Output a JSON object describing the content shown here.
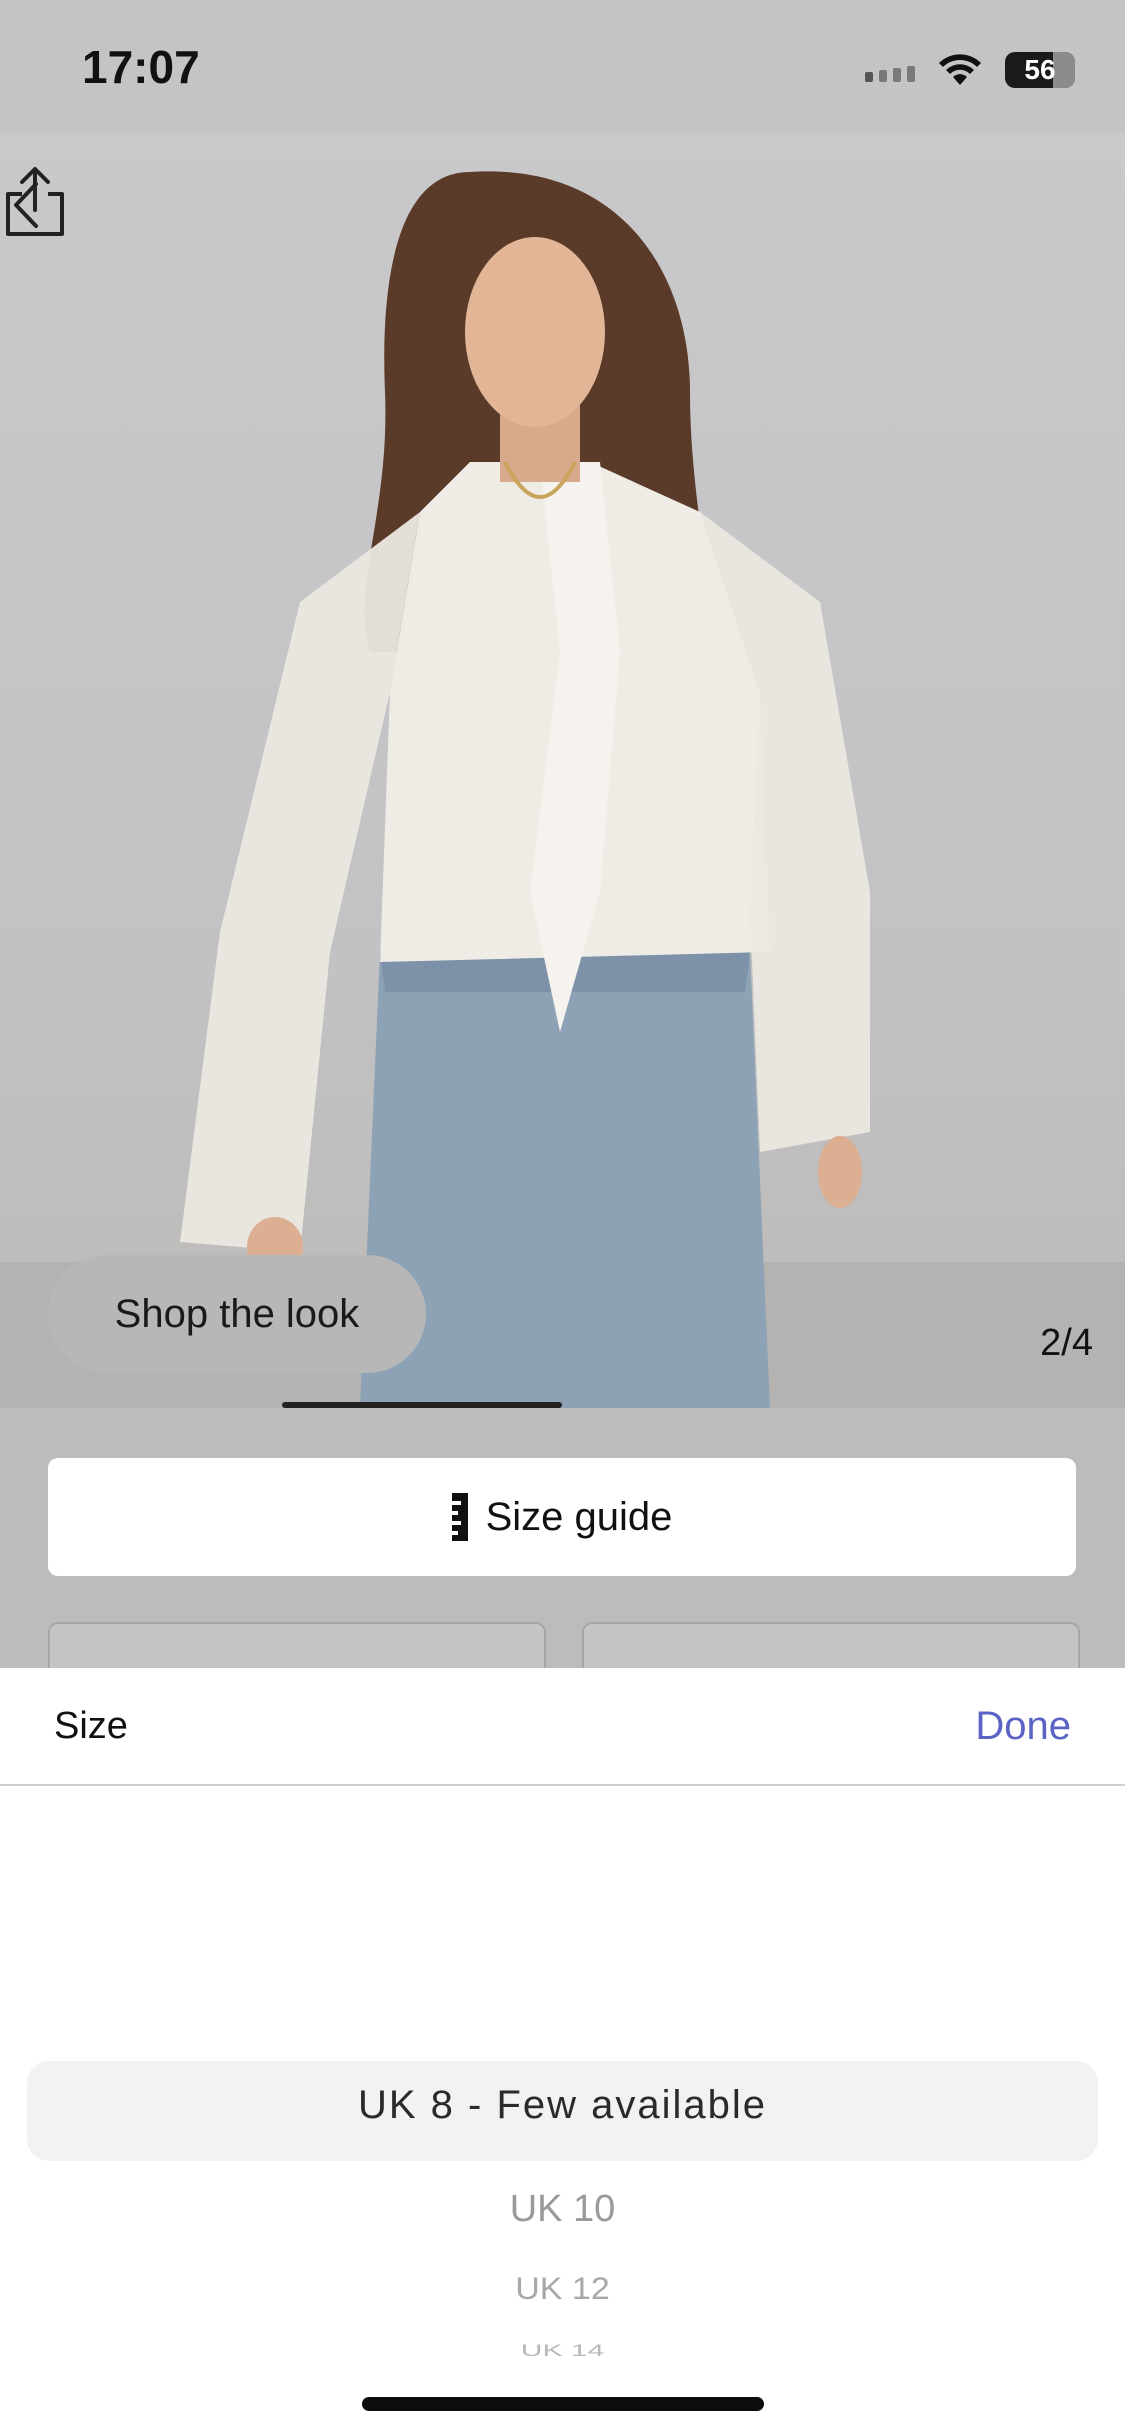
{
  "status": {
    "time": "17:07",
    "battery": "56"
  },
  "product": {
    "image_counter": "2/4",
    "shop_the_look_label": "Shop the look",
    "size_guide_label": "Size guide"
  },
  "size_sheet": {
    "title": "Size",
    "done_label": "Done",
    "options": [
      "UK 8 - Few available",
      "UK 10",
      "UK 12",
      "UK 14"
    ]
  },
  "icons": {
    "back": "chevron-left-icon",
    "share": "share-icon",
    "size_guide": "ruler-icon"
  },
  "colors": {
    "done_accent": "#5b63c4"
  }
}
